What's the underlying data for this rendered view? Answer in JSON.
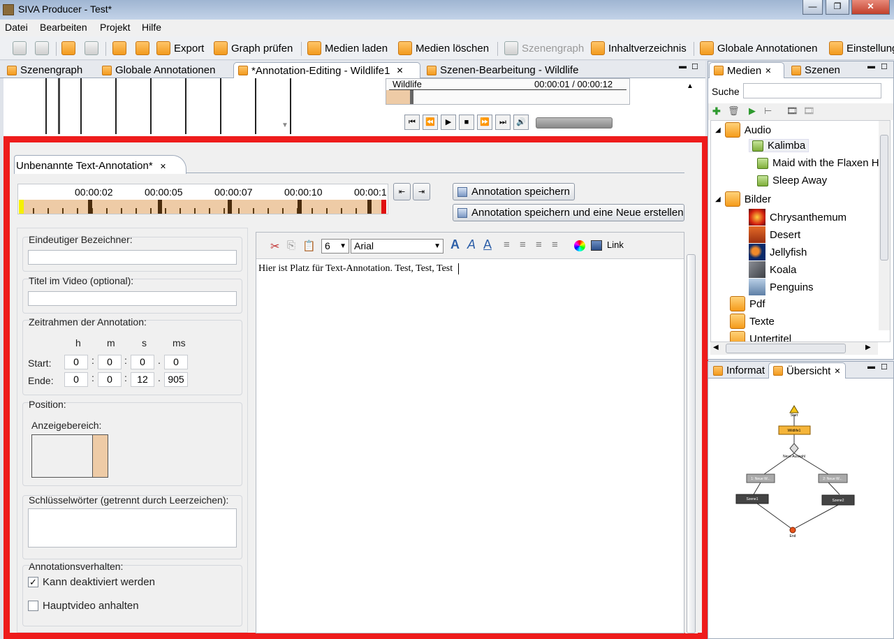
{
  "window": {
    "title": "SIVA Producer - Test*",
    "minimize": "—",
    "maximize": "❐",
    "close": "✕"
  },
  "menu": [
    "Datei",
    "Bearbeiten",
    "Projekt",
    "Hilfe"
  ],
  "toolbar": {
    "export": "Export",
    "graph_check": "Graph prüfen",
    "load_media": "Medien laden",
    "delete_media": "Medien löschen",
    "scenegraph": "Szenengraph",
    "toc": "Inhaltverzeichnis",
    "global_annotations": "Globale Annotationen",
    "settings": "Einstellung"
  },
  "editor_tabs": [
    {
      "label": "Szenengraph"
    },
    {
      "label": "Globale Annotationen"
    },
    {
      "label": "*Annotation-Editing - Wildlife1"
    },
    {
      "label": "Szenen-Bearbeitung -   Wildlife"
    }
  ],
  "preview": {
    "clip_name": "Wildlife",
    "timecode": "00:00:01 / 00:00:12"
  },
  "annotation": {
    "tab_label": "Unbenannte Text-Annotation*",
    "timeline_ticks": [
      "00:00:02",
      "00:00:05",
      "00:00:07",
      "00:00:10",
      "00:00:1"
    ],
    "save_button": "Annotation speichern",
    "save_new_button": "Annotation speichern und eine Neue erstellen",
    "identifier_label": "Eindeutiger Bezeichner:",
    "identifier_value": "",
    "video_title_label": "Titel im Video (optional):",
    "video_title_value": "",
    "timeframe_label": "Zeitrahmen der Annotation:",
    "units": {
      "h": "h",
      "m": "m",
      "s": "s",
      "ms": "ms"
    },
    "start_label": "Start:",
    "end_label": "Ende:",
    "start": {
      "h": "0",
      "m": "0",
      "s": "0",
      "ms": "0"
    },
    "end": {
      "h": "0",
      "m": "0",
      "s": "12",
      "ms": "905"
    },
    "sep_colon": ":",
    "sep_dot": ".",
    "position_label": "Position:",
    "display_area_label": "Anzeigebereich:",
    "keywords_label": "Schlüsselwörter (getrennt durch Leerzeichen):",
    "keywords_value": "",
    "behaviour_label": "Annotationsverhalten:",
    "can_disable_label": "Kann deaktiviert werden",
    "can_disable_checked": true,
    "pause_video_label": "Hauptvideo anhalten",
    "pause_video_checked": false,
    "font_size": "6",
    "font_family": "Arial",
    "link_label": "Link",
    "text_content": "Hier ist Platz für Text-Annotation. Test, Test, Test"
  },
  "media_panel": {
    "tabs": [
      "Medien",
      "Szenen"
    ],
    "search_label": "Suche",
    "search_value": "",
    "tree": [
      {
        "label": "Audio",
        "type": "folder",
        "children": [
          "Kalimba",
          "Maid with the Flaxen H",
          "Sleep Away"
        ]
      },
      {
        "label": "Bilder",
        "type": "folder",
        "children": [
          "Chrysanthemum",
          "Desert",
          "Jellyfish",
          "Koala",
          "Penguins"
        ]
      },
      {
        "label": "Pdf",
        "type": "folder"
      },
      {
        "label": "Texte",
        "type": "folder"
      },
      {
        "label": "Untertitel",
        "type": "folder"
      }
    ]
  },
  "overview_panel": {
    "tabs": [
      "Informat",
      "Übersicht"
    ],
    "graph_labels": {
      "start": "Start",
      "scene": "Wildlife1",
      "fork": "Neue Auswahl",
      "branch1": "1: Neue W...",
      "branch2": "2: Neue W...",
      "scene1": "Szene1",
      "scene2": "Szene2",
      "end": "End"
    }
  },
  "colors": {
    "highlight": "#ee1c1c",
    "timeline_fill": "#eecba6",
    "accent_orange": "#f29a1d"
  }
}
